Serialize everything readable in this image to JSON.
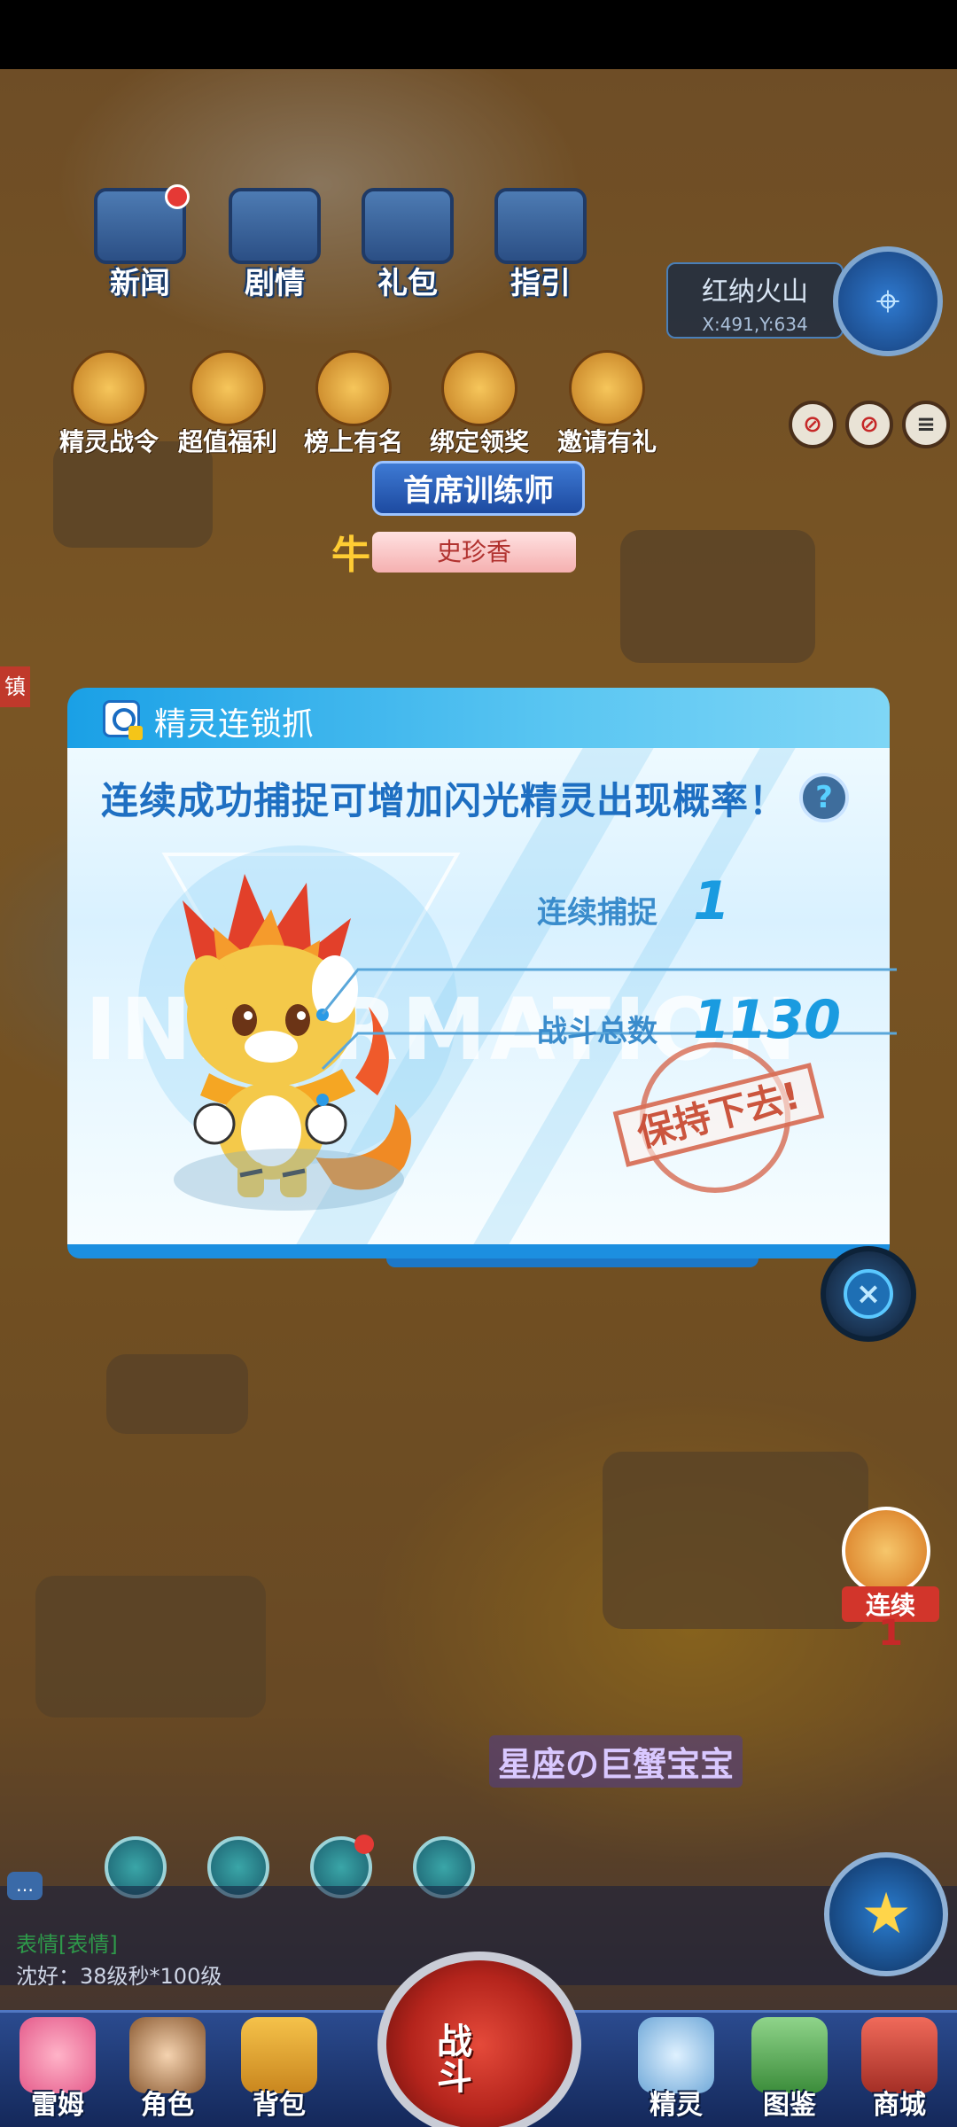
{
  "top_menu": [
    {
      "label": "新闻",
      "icon": "news-icon",
      "badge": true
    },
    {
      "label": "剧情",
      "icon": "story-icon",
      "badge": false
    },
    {
      "label": "礼包",
      "icon": "gift-pack-icon",
      "badge": false
    },
    {
      "label": "指引",
      "icon": "guide-icon",
      "badge": false
    }
  ],
  "promos": [
    {
      "label": "精灵战令",
      "icon": "battle-pass-icon"
    },
    {
      "label": "超值福利",
      "icon": "welfare-icon"
    },
    {
      "label": "榜上有名",
      "icon": "ranking-icon"
    },
    {
      "label": "绑定领奖",
      "icon": "bind-reward-icon"
    },
    {
      "label": "邀请有礼",
      "icon": "invite-icon"
    }
  ],
  "location": {
    "name": "红纳火山",
    "coords": "X:491,Y:634"
  },
  "player": {
    "title": "首席训练师",
    "name": "史珍香",
    "zodiac": "牛"
  },
  "dialog": {
    "title": "精灵连锁抓",
    "headline": "连续成功捕捉可增加闪光精灵出现概率！",
    "help_label": "?",
    "bg_word": "INFORMATION",
    "stats": [
      {
        "label": "连续捕捉",
        "value": "1"
      },
      {
        "label": "战斗总数",
        "value": "1130"
      }
    ],
    "stamp": "保持下去!",
    "close_label": "×",
    "colors": {
      "header": "#1aa0e6",
      "accent": "#1a9be0",
      "stamp": "#d46046"
    }
  },
  "streak_badge": {
    "label": "连续",
    "count": "1"
  },
  "event_banner": "星座の巨蟹宝宝",
  "chat": {
    "line1": "表情[表情]",
    "line2": "沈好：38级秒*100级"
  },
  "battle_button": "战斗",
  "bottom_nav": [
    {
      "label": "雷姆",
      "icon": "pet-avatar-icon"
    },
    {
      "label": "角色",
      "icon": "character-icon"
    },
    {
      "label": "背包",
      "icon": "backpack-icon"
    },
    {
      "label": "精灵",
      "icon": "sprite-icon"
    },
    {
      "label": "图鉴",
      "icon": "encyclopedia-icon"
    },
    {
      "label": "商城",
      "icon": "shop-icon"
    }
  ]
}
